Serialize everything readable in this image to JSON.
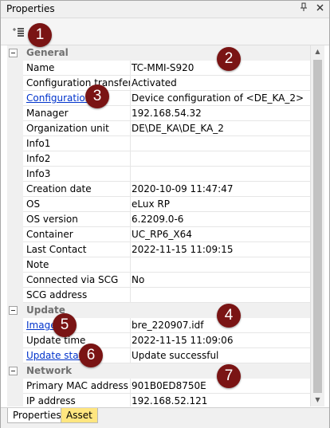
{
  "panel": {
    "title": "Properties",
    "pin_icon": "pin-icon",
    "close_icon": "close-icon"
  },
  "toolbar": {
    "sort_icon": "categorized-sort-icon"
  },
  "categories": {
    "general": "General",
    "update": "Update",
    "network": "Network"
  },
  "rows": [
    {
      "name": "Name",
      "value": "TC-MMI-S920"
    },
    {
      "name": "Configuration transfer",
      "value": "Activated"
    },
    {
      "name": "Configuration",
      "value": "Device configuration of <DE_KA_2>",
      "link": true
    },
    {
      "name": "Manager",
      "value": "192.168.54.32"
    },
    {
      "name": "Organization unit",
      "value": "DE\\DE_KA\\DE_KA_2"
    },
    {
      "name": "Info1",
      "value": ""
    },
    {
      "name": "Info2",
      "value": ""
    },
    {
      "name": "Info3",
      "value": ""
    },
    {
      "name": "Creation date",
      "value": "2020-10-09 11:47:47"
    },
    {
      "name": "OS",
      "value": "eLux RP"
    },
    {
      "name": "OS version",
      "value": "6.2209.0-6"
    },
    {
      "name": "Container",
      "value": "UC_RP6_X64"
    },
    {
      "name": "Last Contact",
      "value": "2022-11-15 11:09:15"
    },
    {
      "name": "Note",
      "value": ""
    },
    {
      "name": "Connected via SCG",
      "value": "No"
    },
    {
      "name": "SCG address",
      "value": ""
    },
    {
      "name": "Image",
      "value": "bre_220907.idf",
      "link": true
    },
    {
      "name": "Update time",
      "value": "2022-11-15 11:09:06"
    },
    {
      "name": "Update state",
      "value": "Update successful",
      "link": true
    },
    {
      "name": "Primary MAC address",
      "value": "901B0ED8750E"
    },
    {
      "name": "IP address",
      "value": "192.168.52.121"
    }
  ],
  "badges": [
    "1",
    "2",
    "3",
    "4",
    "5",
    "6",
    "7"
  ],
  "tabs": {
    "properties": "Properties",
    "asset": "Asset"
  },
  "colors": {
    "badge": "#7a1414",
    "link": "#0033cc",
    "asset_tab": "#ffe680"
  }
}
